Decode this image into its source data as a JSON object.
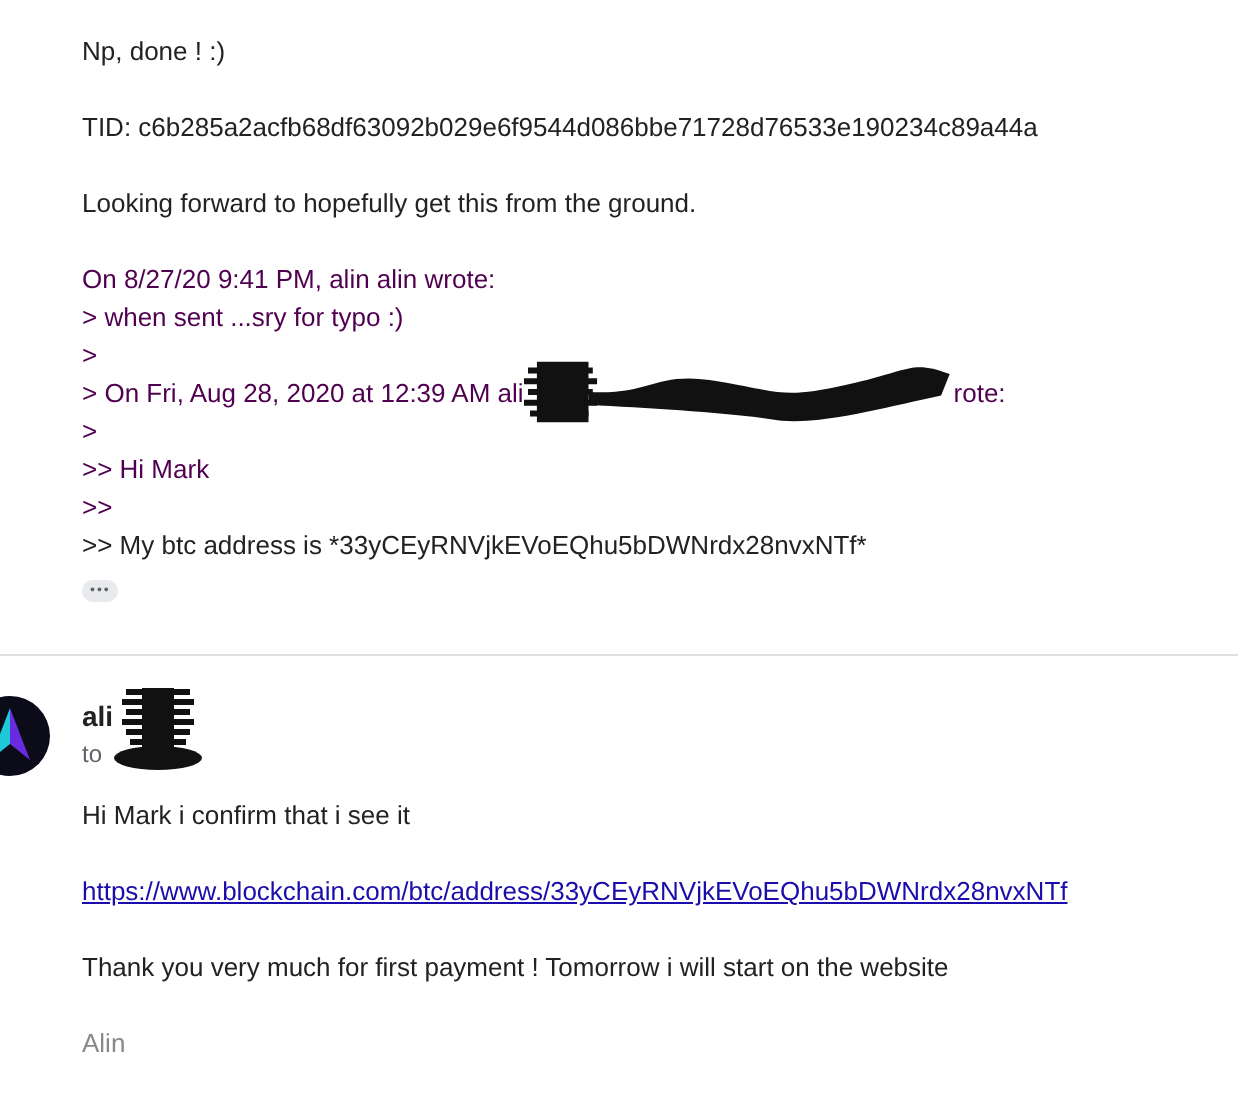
{
  "message_1": {
    "paragraphs": [
      "Np, done ! :)",
      "TID: c6b285a2acfb68df63092b029e6f9544d086bbe71728d76533e190234c89a44a",
      "Looking forward to hopefully get this from the ground."
    ],
    "quote": [
      {
        "kind": "quoted",
        "text": "On 8/27/20 9:41 PM, alin alin wrote:"
      },
      {
        "kind": "quoted",
        "text": "> when sent ...sry for typo :)"
      },
      {
        "kind": "quoted",
        "text": ">"
      },
      {
        "kind": "redacted",
        "before": "> On Fri, Aug 28, 2020 at 12:39 AM ali",
        "after": "rote:"
      },
      {
        "kind": "quoted",
        "text": ">"
      },
      {
        "kind": "quoted",
        "text": ">> Hi Mark"
      },
      {
        "kind": "quoted",
        "text": ">>"
      },
      {
        "kind": "plain",
        "text": ">> My btc address is *33yCEyRNVjkEVoEQhu5bDWNrdx28nvxNTf*"
      }
    ],
    "more_button": "•••"
  },
  "message_2": {
    "sender": "ali",
    "recipient_prefix": "to",
    "body": [
      {
        "kind": "plain",
        "text": "Hi Mark i confirm that i see it"
      },
      {
        "kind": "link",
        "text": "https://www.blockchain.com/btc/address/33yCEyRNVjkEVoEQhu5bDWNrdx28nvxNTf"
      },
      {
        "kind": "plain",
        "text": "Thank you very much for first payment !  Tomorrow i will start on the website"
      },
      {
        "kind": "signature",
        "text": "Alin"
      }
    ]
  }
}
